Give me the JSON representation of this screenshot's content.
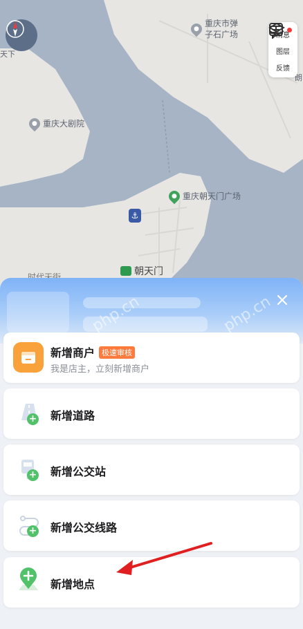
{
  "map": {
    "pois": [
      {
        "label": "重庆市弹子石广场",
        "line1": "重庆市弹",
        "line2": "子石广场",
        "icon": "poi-icon",
        "color": "#9aa0aa"
      },
      {
        "label": "重庆大剧院",
        "icon": "poi-icon",
        "color": "#9aa0aa"
      },
      {
        "label": "重庆朝天门广场",
        "icon": "park-icon",
        "color": "#3fa35b"
      },
      {
        "label": "朝天门",
        "icon": "metro-icon",
        "color": "#2e9a4f"
      },
      {
        "label": "天下",
        "icon": "",
        "color": ""
      },
      {
        "label": "朗",
        "icon": "",
        "color": ""
      },
      {
        "label": "时代天街",
        "icon": "",
        "color": ""
      }
    ],
    "tools": [
      {
        "label": "消息",
        "icon": "message-icon",
        "badge": true
      },
      {
        "label": "图层",
        "icon": "layers-icon",
        "badge": false
      },
      {
        "label": "反馈",
        "icon": "feedback-icon",
        "badge": false
      }
    ]
  },
  "sheet": {
    "watermark": "php.cn",
    "merchant": {
      "title": "新增商户",
      "tag": "极速审核",
      "subtitle": "我是店主，立刻新增商户",
      "icon": "shop-icon",
      "icon_color": "#f9a23b"
    },
    "items": [
      {
        "title": "新增道路",
        "icon": "road-icon"
      },
      {
        "title": "新增公交站",
        "icon": "bus-stop-icon"
      },
      {
        "title": "新增公交线路",
        "icon": "bus-route-icon"
      },
      {
        "title": "新增地点",
        "icon": "location-icon"
      }
    ]
  },
  "colors": {
    "water": "#a6b4c5",
    "land": "#e7e6e3",
    "accent_green": "#52c26a",
    "arrow_red": "#e02020"
  }
}
